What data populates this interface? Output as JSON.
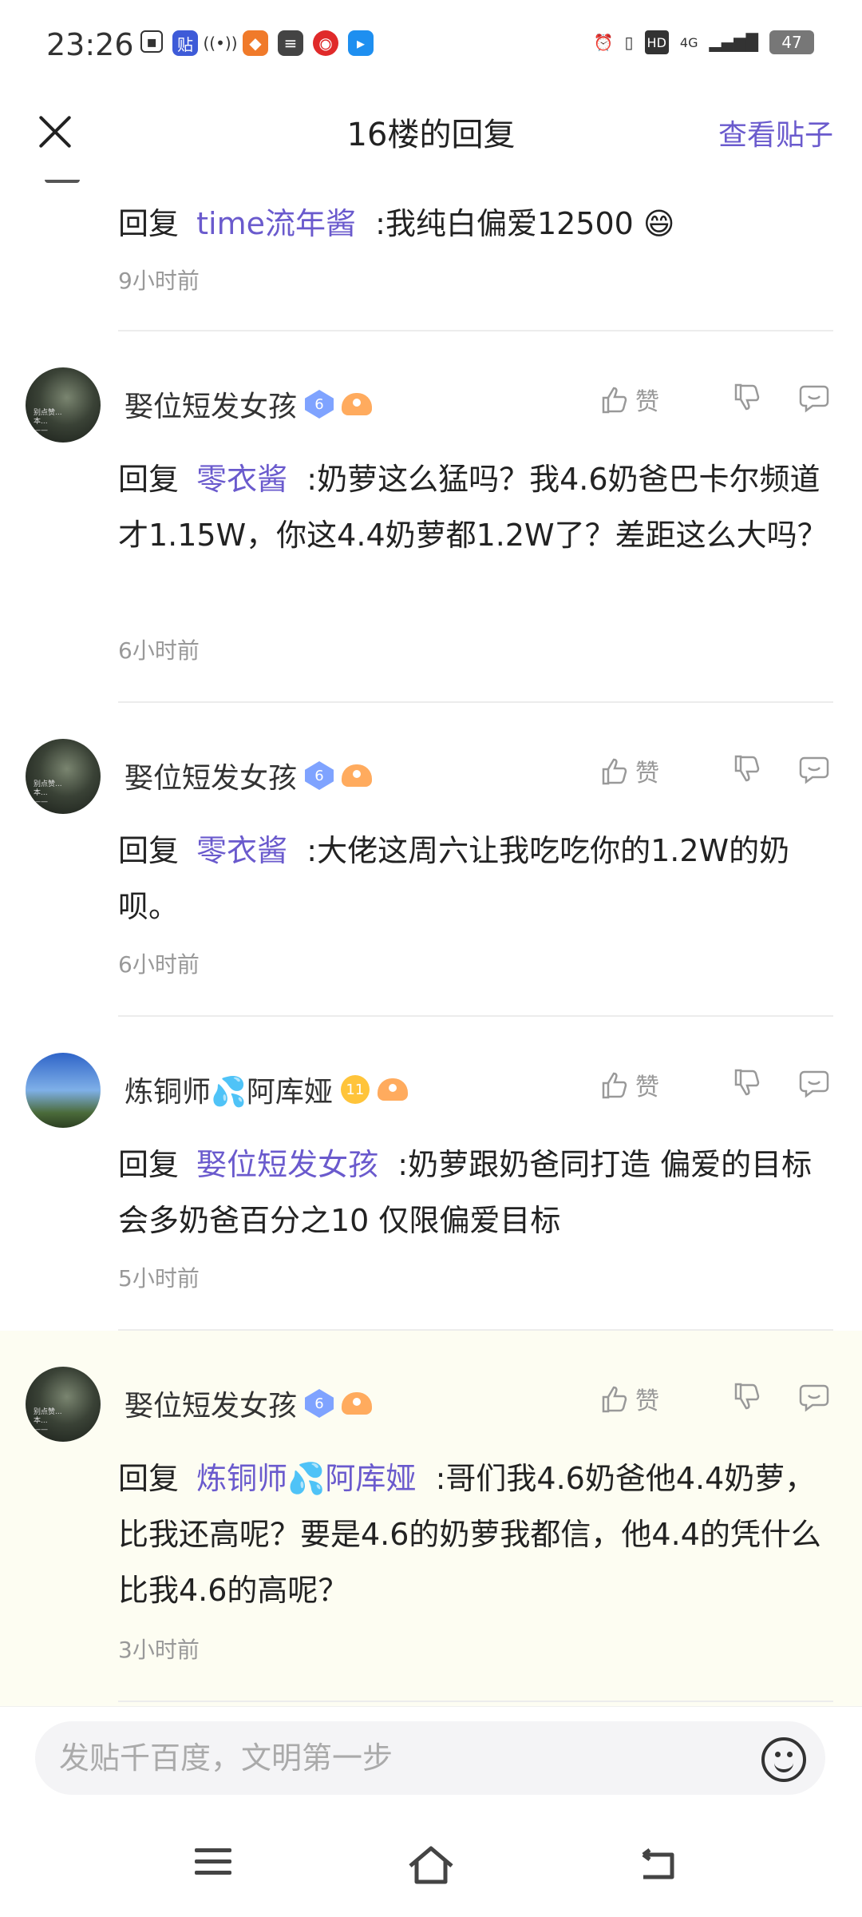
{
  "status_bar": {
    "time": "23:26",
    "network": "4G",
    "hd": "HD",
    "battery": "47"
  },
  "header": {
    "title": "16楼的回复",
    "view_post": "查看贴子"
  },
  "replies": [
    {
      "reply_prefix": "回复",
      "mention": "time流年酱",
      "text": " :我纯白偏爱12500 😄",
      "time": "9小时前"
    },
    {
      "username": "娶位短发女孩",
      "level": "6",
      "like_label": "赞",
      "reply_prefix": "回复",
      "mention": "零衣酱",
      "text": " :奶萝这么猛吗？我4.6奶爸巴卡尔频道才1.15W，你这4.4奶萝都1.2W了？差距这么大吗？",
      "time": "6小时前"
    },
    {
      "username": "娶位短发女孩",
      "level": "6",
      "like_label": "赞",
      "reply_prefix": "回复",
      "mention": "零衣酱",
      "text": " :大佬这周六让我吃吃你的1.2W的奶呗。",
      "time": "6小时前"
    },
    {
      "username": "炼铜师💦阿库娅",
      "level": "11",
      "like_label": "赞",
      "reply_prefix": "回复",
      "mention": "娶位短发女孩",
      "text": " :奶萝跟奶爸同打造 偏爱的目标会多奶爸百分之10 仅限偏爱目标",
      "time": "5小时前"
    },
    {
      "username": "娶位短发女孩",
      "level": "6",
      "like_label": "赞",
      "reply_prefix": "回复",
      "mention": "炼铜师💦阿库娅",
      "text": " :哥们我4.6奶爸他4.4奶萝，比我还高呢？要是4.6的奶萝我都信，他4.4的凭什么比我4.6的高呢？",
      "time": "3小时前"
    }
  ],
  "input": {
    "placeholder": "发贴千百度，文明第一步"
  },
  "colors": {
    "accent": "#6a5acd",
    "highlight_bg": "#fdfdf2"
  }
}
